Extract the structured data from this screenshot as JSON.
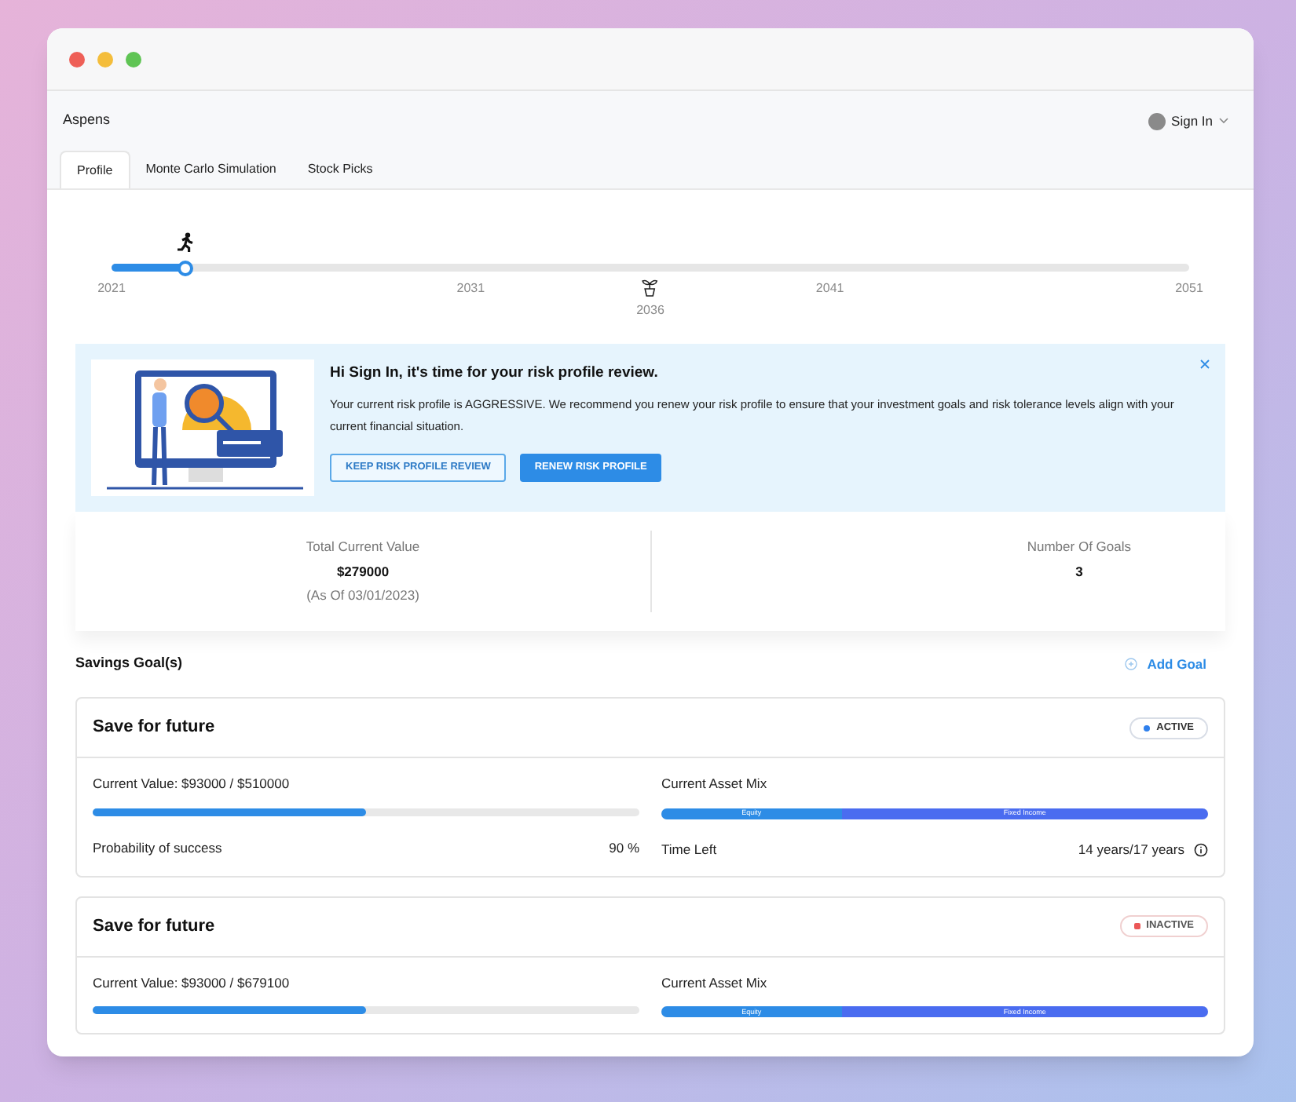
{
  "header": {
    "brand": "Aspens",
    "user": "Sign In"
  },
  "tabs": [
    {
      "label": "Profile",
      "selected": true
    },
    {
      "label": "Monte Carlo Simulation",
      "selected": false
    },
    {
      "label": "Stock Picks",
      "selected": false
    }
  ],
  "timeline": {
    "level": 0.068,
    "ticks": [
      "2021",
      "2031",
      "2041",
      "2051"
    ],
    "goal_year": "2036"
  },
  "banner": {
    "title": "Hi Sign In, it's time for your risk profile review.",
    "body": "Your current risk profile is AGGRESSIVE. We recommend you renew your risk profile to ensure that your investment goals and risk tolerance levels align with your current financial situation.",
    "buttons": [
      {
        "label": "KEEP RISK PROFILE REVIEW",
        "kind": "outline"
      },
      {
        "label": "RENEW RISK PROFILE",
        "kind": "primary"
      }
    ]
  },
  "summary": {
    "total_label": "Total Current Value",
    "total_value": "$279000",
    "total_note": "(As Of 03/01/2023)",
    "goals_label": "Number Of Goals",
    "goals_value": "3"
  },
  "goals_section": {
    "title": "Savings Goal(s)",
    "add": "Add Goal"
  },
  "goals": [
    {
      "name": "Save for future",
      "status": "ACTIVE",
      "active": true,
      "color": "#2f80ed",
      "value": "Current Value: $93000 / $510000",
      "level": 0.5,
      "mix_label": "Current Asset Mix",
      "mix": [
        {
          "label": "Equity",
          "level": 0.33
        },
        {
          "label": "Fixed Income",
          "level": 0.67
        }
      ],
      "probability_label": "Probability of success",
      "probability": "90 %",
      "time_label": "Time Left",
      "time": "14 years/17 years"
    },
    {
      "name": "Save for future",
      "status": "INACTIVE",
      "active": false,
      "color": "#eb5757",
      "value": "Current Value: $93000 / $679100",
      "level": 0.5,
      "mix_label": "Current Asset Mix",
      "mix": [
        {
          "label": "Equity",
          "level": 0.33
        },
        {
          "label": "Fixed Income",
          "level": 0.67
        }
      ]
    }
  ]
}
